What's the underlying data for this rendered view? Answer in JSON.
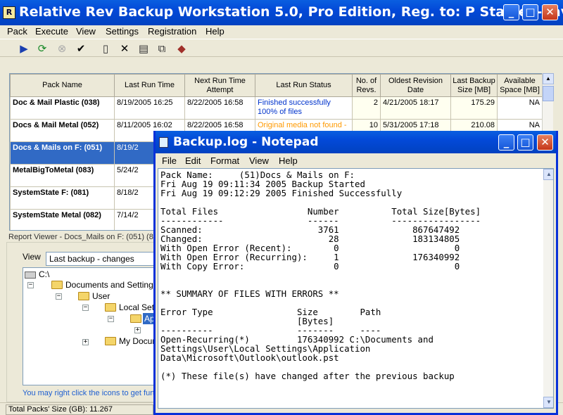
{
  "app": {
    "title": "Relative Rev Backup Workstation 5.0, Pro Edition, Reg. to: P Stanley-davi...",
    "icon_label": "R",
    "menu": [
      "Pack",
      "Execute",
      "View",
      "Settings",
      "Registration",
      "Help"
    ],
    "toolbar_icons": [
      "run-icon",
      "refresh-icon",
      "stop-icon",
      "check-icon",
      "new-icon",
      "delete-icon",
      "properties-icon",
      "copy-icon",
      "help-book-icon"
    ]
  },
  "grid": {
    "columns": [
      "Pack Name",
      "Last Run Time",
      "Next Run Time Attempt",
      "Last Run Status",
      "No. of Revs.",
      "Oldest Revision Date",
      "Last Backup Size [MB]",
      "Available Space [MB]"
    ],
    "rows": [
      {
        "name": "Doc & Mail Plastic (038)",
        "last_run": "8/19/2005 16:25",
        "next_run": "8/22/2005 16:58",
        "status1": "Finished successfully",
        "status2": "100% of files",
        "revs": "2",
        "oldest": "4/21/2005 18:17",
        "size": "175.29",
        "space": "NA"
      },
      {
        "name": "Docs & Mail Metal (052)",
        "last_run": "8/11/2005 16:02",
        "next_run": "8/22/2005 16:58",
        "status1": "Original media not found -",
        "status2": "",
        "revs": "10",
        "oldest": "5/31/2005 17:18",
        "size": "210.08",
        "space": "NA"
      },
      {
        "name": "Docs & Mails on F: (051)",
        "last_run": "8/19/2",
        "next_run": "",
        "status1": "",
        "status2": "",
        "revs": "",
        "oldest": "",
        "size": "",
        "space": ""
      },
      {
        "name": "MetalBigToMetal (083)",
        "last_run": "5/24/2",
        "next_run": "",
        "status1": "",
        "status2": "",
        "revs": "",
        "oldest": "",
        "size": "",
        "space": ""
      },
      {
        "name": "SystemState F: (081)",
        "last_run": "8/18/2",
        "next_run": "",
        "status1": "",
        "status2": "",
        "revs": "",
        "oldest": "",
        "size": "",
        "space": ""
      },
      {
        "name": "SystemState Metal (082)",
        "last_run": "7/14/2",
        "next_run": "",
        "status1": "",
        "status2": "",
        "revs": "",
        "oldest": "",
        "size": "",
        "space": ""
      }
    ]
  },
  "report": {
    "label": "Report Viewer - Docs_Mails on F: (051) (8/",
    "view_label": "View",
    "view_value": "Last backup - changes",
    "tree": [
      "C:\\",
      "Documents and Settings",
      "User",
      "Local Settin",
      "Ap",
      "My Docum"
    ],
    "hint": "You may right click the icons to get furth"
  },
  "status": {
    "total": "Total Packs' Size (GB): 11.267"
  },
  "notepad": {
    "title": "Backup.log - Notepad",
    "menu": [
      "File",
      "Edit",
      "Format",
      "View",
      "Help"
    ],
    "lines": [
      "Pack Name:     (51)Docs & Mails on F:",
      "Fri Aug 19 09:11:34 2005 Backup Started",
      "Fri Aug 19 09:12:29 2005 Finished Successfully",
      "",
      "Total Files                 Number          Total Size[Bytes]",
      "------------                ------          -----------------",
      "Scanned:                      3761              867647492",
      "Changed:                        28              183134805",
      "With Open Error (Recent):        0                      0",
      "With Open Error (Recurring):     1              176340992",
      "With Copy Error:                 0                      0",
      "",
      "",
      "** SUMMARY OF FILES WITH ERRORS **",
      "",
      "Error Type                Size        Path",
      "                          [Bytes]",
      "----------                -------     ----",
      "Open-Recurring(*)         176340992 C:\\Documents and",
      "Settings\\User\\Local Settings\\Application",
      "Data\\Microsoft\\Outlook\\outlook.pst",
      "",
      "(*) These file(s) have changed after the previous backup"
    ]
  }
}
